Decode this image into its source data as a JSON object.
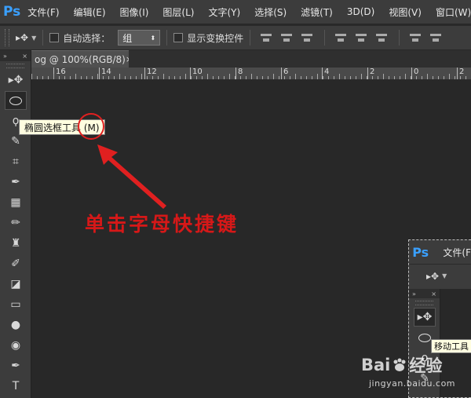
{
  "app": {
    "logo": "Ps"
  },
  "menu": [
    "文件(F)",
    "编辑(E)",
    "图像(I)",
    "图层(L)",
    "文字(Y)",
    "选择(S)",
    "滤镜(T)",
    "3D(D)",
    "视图(V)",
    "窗口(W)"
  ],
  "options_bar": {
    "tool_icon": "move-tool-icon",
    "auto_select_label": "自动选择：",
    "auto_select_checked": false,
    "auto_select_value": "组",
    "show_transform_label": "显示变换控件",
    "show_transform_checked": false
  },
  "document": {
    "tab_title": "og @ 100%(RGB/8)",
    "close": "×"
  },
  "ruler": {
    "labels": [
      "16",
      "14",
      "12",
      "10",
      "8",
      "6",
      "4",
      "2",
      "0",
      "2"
    ]
  },
  "tool_panel": {
    "header_collapse": "»",
    "header_close": "×",
    "tools": [
      "move-tool-icon",
      "elliptical-marquee-icon",
      "lasso-icon",
      "quick-select-icon",
      "crop-icon",
      "eyedropper-icon",
      "healing-brush-icon",
      "brush-icon",
      "clone-stamp-icon",
      "history-brush-icon",
      "eraser-icon",
      "gradient-icon",
      "blur-icon",
      "dodge-icon",
      "pen-icon",
      "type-icon"
    ]
  },
  "tooltip": {
    "text": "椭圆选框工具 (M)"
  },
  "annotation": {
    "text": "单击字母快捷键",
    "color": "#d61818"
  },
  "inset": {
    "logo": "Ps",
    "menu_first": "文件(F",
    "tooltip": "移动工具"
  },
  "watermark": {
    "brand_left": "Bai",
    "brand_right": "经验",
    "url": "jingyan.baidu.com"
  }
}
